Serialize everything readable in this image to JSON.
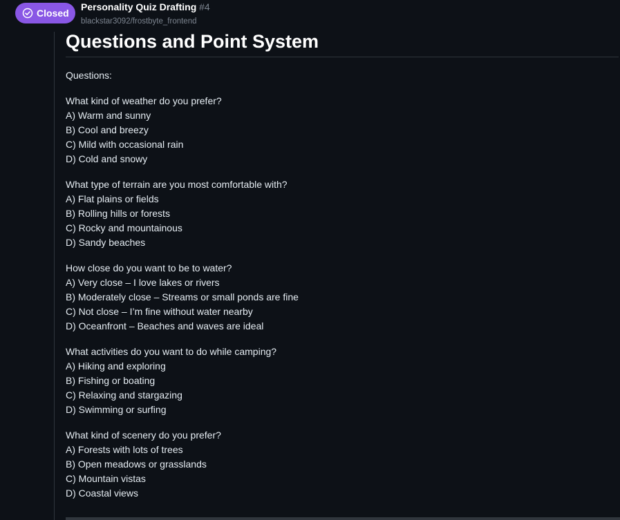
{
  "header": {
    "status": "Closed",
    "title": "Personality Quiz Drafting",
    "number": "#4",
    "repo": "blackstar3092/frostbyte_frontend"
  },
  "section": {
    "heading": "Questions and Point System",
    "intro": "Questions:"
  },
  "questions": [
    {
      "q": "What kind of weather do you prefer?",
      "options": [
        "A) Warm and sunny",
        "B) Cool and breezy",
        "C) Mild with occasional rain",
        "D) Cold and snowy"
      ]
    },
    {
      "q": "What type of terrain are you most comfortable with?",
      "options": [
        "A) Flat plains or fields",
        "B) Rolling hills or forests",
        "C) Rocky and mountainous",
        "D) Sandy beaches"
      ]
    },
    {
      "q": "How close do you want to be to water?",
      "options": [
        "A) Very close – I love lakes or rivers",
        "B) Moderately close – Streams or small ponds are fine",
        "C) Not close – I’m fine without water nearby",
        "D) Oceanfront – Beaches and waves are ideal"
      ]
    },
    {
      "q": "What activities do you want to do while camping?",
      "options": [
        "A) Hiking and exploring",
        "B) Fishing or boating",
        "C) Relaxing and stargazing",
        "D) Swimming or surfing"
      ]
    },
    {
      "q": "What kind of scenery do you prefer?",
      "options": [
        "A) Forests with lots of trees",
        "B) Open meadows or grasslands",
        "C) Mountain vistas",
        "D) Coastal views"
      ]
    }
  ],
  "colors": {
    "background": "#0d1117",
    "badge": "#8957e5",
    "text": "#e6edf3",
    "muted": "#7d8590",
    "border": "#30363d"
  },
  "icons": {
    "status": "check-circle-icon"
  }
}
